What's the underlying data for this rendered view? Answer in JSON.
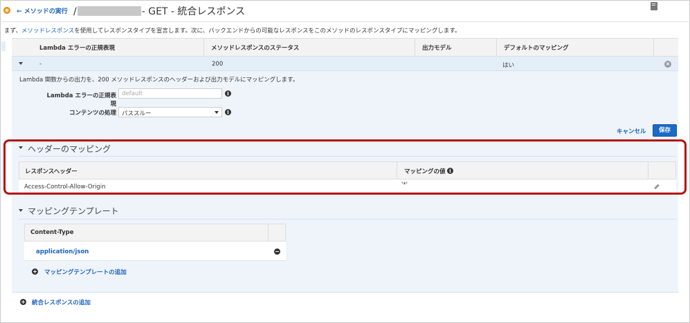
{
  "header": {
    "back_label": "メソッドの実行",
    "title_prefix": "/",
    "title_suffix": "- GET - 統合レスポンス"
  },
  "intro": {
    "before_link": "まず、",
    "link": "メソッドレスポンス",
    "after_link": "を使用してレスポンスタイプを宣言します。次に、バックエンドからの可能なレスポンスをこのメソッドのレスポンスタイプにマッピングします。"
  },
  "table": {
    "headers": [
      "Lambda エラーの正規表現",
      "メソッドレスポンスのステータス",
      "出力モデル",
      "デフォルトのマッピング"
    ],
    "row": {
      "regex": "-",
      "status": "200",
      "model": "",
      "default": "はい"
    }
  },
  "detail": {
    "description": "Lambda 関数からの出力を、200 メソッドレスポンスのヘッダーおよび出力モデルにマッピングします。",
    "regex_label": "Lambda エラーの正規表現",
    "regex_placeholder": "default",
    "content_label": "コンテンツの処理",
    "content_value": "パススルー",
    "cancel": "キャンセル",
    "save": "保存"
  },
  "header_mapping": {
    "title": "ヘッダーのマッピング",
    "col_header": "レスポンスヘッダー",
    "col_value": "マッピングの値",
    "rows": [
      {
        "header": "Access-Control-Allow-Origin",
        "value": "'*'"
      }
    ]
  },
  "mapping_template": {
    "title": "マッピングテンプレート",
    "col": "Content-Type",
    "rows": [
      "application/json"
    ],
    "add_label": "マッピングテンプレートの追加"
  },
  "footer": {
    "add_response": "統合レスポンスの追加"
  },
  "colors": {
    "link": "#1a62c0",
    "highlight": "#b50e0e",
    "save_button": "#1b6ac9"
  }
}
